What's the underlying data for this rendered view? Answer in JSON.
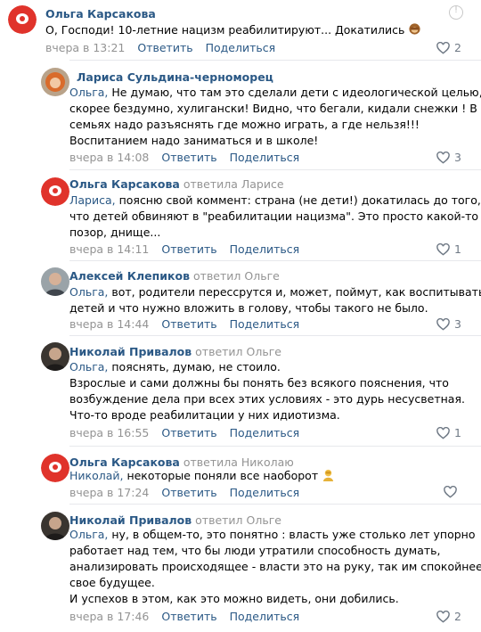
{
  "comments": [
    {
      "author": "Ольга Карсакова",
      "reply_text": "",
      "addressee": "",
      "lines": [
        "О, Господи! 10-летние нацизм реабилитируют... Докатились"
      ],
      "time": "вчера в 13:21",
      "reply_label": "Ответить",
      "share_label": "Поделиться",
      "likes": "2",
      "avatar": "red-circle-logo"
    },
    {
      "author": "Лариса Сульдина-черноморец",
      "reply_text": "",
      "addressee": "Ольга,",
      "lines": [
        " Не думаю, что там это сделали дети с идеологической целью,",
        "скорее бездумно, хулигански! Видно, что бегали, кидали снежки ! В",
        "семьях надо разъяснять где можно играть, а где нельзя!!!",
        "Воспитанием надо заниматься и в школе!"
      ],
      "time": "вчера в 14:08",
      "reply_label": "Ответить",
      "share_label": "Поделиться",
      "likes": "3",
      "avatar": "woman-photo"
    },
    {
      "author": "Ольга Карсакова",
      "reply_text": "ответила Ларисе",
      "addressee": "Лариса,",
      "lines": [
        " поясню свой коммент: страна (не дети!) докатилась до того,",
        "что детей обвиняют в \"реабилитации нацизма\". Это просто какой-то",
        "позор, днище..."
      ],
      "time": "вчера в 14:11",
      "reply_label": "Ответить",
      "share_label": "Поделиться",
      "likes": "1",
      "avatar": "red-circle-logo"
    },
    {
      "author": "Алексей Клепиков",
      "reply_text": "ответил Ольге",
      "addressee": "Ольга,",
      "lines": [
        " вот, родители перессрутся и, может, поймут, как воспитывать",
        "детей и что нужно вложить в голову, чтобы такого не было."
      ],
      "time": "вчера в 14:44",
      "reply_label": "Ответить",
      "share_label": "Поделиться",
      "likes": "3",
      "avatar": "man-photo"
    },
    {
      "author": "Николай Привалов",
      "reply_text": "ответил Ольге",
      "addressee": "Ольга,",
      "lines": [
        " пояснять, думаю, не стоило.",
        "Взрослые и сами должны бы понять без всякого пояснения, что",
        "возбуждение дела при всех этих условиях - это дурь несусветная.",
        "Что-то вроде реабилитации у них идиотизма."
      ],
      "time": "вчера в 16:55",
      "reply_label": "Ответить",
      "share_label": "Поделиться",
      "likes": "1",
      "avatar": "man-dark-photo"
    },
    {
      "author": "Ольга Карсакова",
      "reply_text": "ответила Николаю",
      "addressee": "Николай,",
      "lines": [
        " некоторые поняли все наоборот"
      ],
      "time": "вчера в 17:24",
      "reply_label": "Ответить",
      "share_label": "Поделиться",
      "likes": "",
      "avatar": "red-circle-logo"
    },
    {
      "author": "Николай Привалов",
      "reply_text": "ответил Ольге",
      "addressee": "Ольга,",
      "lines": [
        " ну, в общем-то, это понятно : власть уже столько лет упорно",
        "работает над тем, что бы люди утратили способность думать,",
        "анализировать происходящее - власти это на руку, так им спокойнее за",
        "свое будущее.",
        "И успехов в этом, как это можно видеть, они добились."
      ],
      "time": "вчера в 17:46",
      "reply_label": "Ответить",
      "share_label": "Поделиться",
      "likes": "2",
      "avatar": "man-dark-photo"
    }
  ],
  "icons": {
    "like": "heart-outline-icon",
    "menu": "report-icon",
    "emoji_monkey": "see-no-evil-monkey-emoji",
    "emoji_person": "person-facepalm-emoji"
  },
  "colors": {
    "author": "#2a5885",
    "meta": "#939393",
    "logo_red": "#e0332b"
  }
}
